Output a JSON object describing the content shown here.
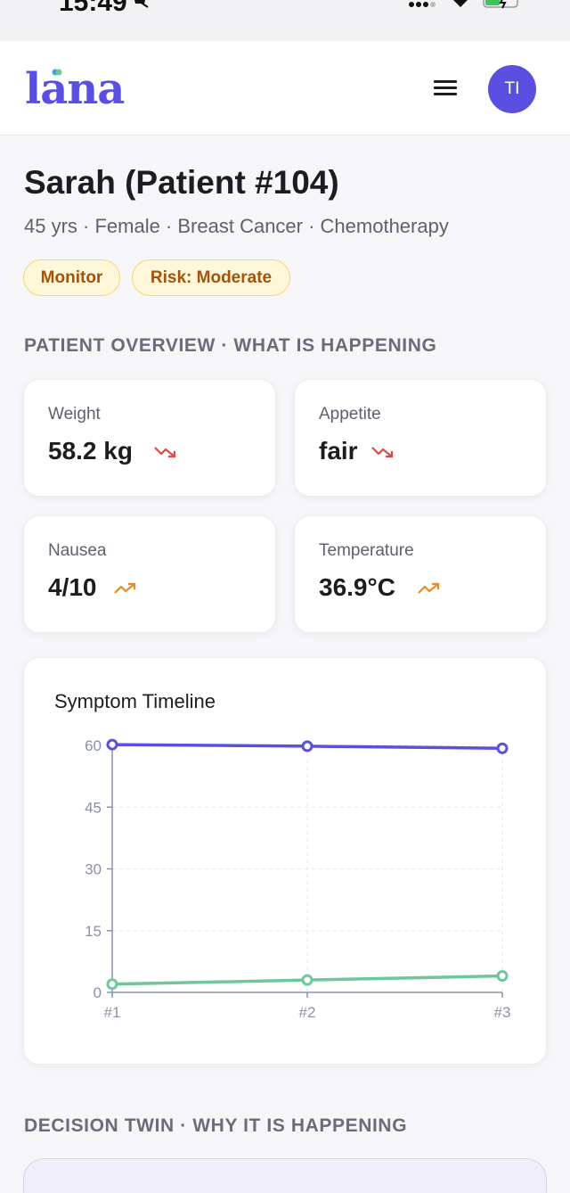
{
  "status_bar": {
    "time": "15:49",
    "icons": [
      "bell-muted-icon",
      "signal-icon",
      "wifi-icon",
      "battery-charging-icon"
    ]
  },
  "header": {
    "logo_text": "lana",
    "menu_icon": "hamburger-menu-icon",
    "avatar_initials": "TI",
    "accent_color": "#5a4fe0"
  },
  "patient": {
    "name": "Sarah (Patient #104)",
    "meta": "45 yrs · Female · Breast Cancer · Chemotherapy",
    "badges": [
      {
        "label": "Monitor",
        "color": "#a1540b"
      },
      {
        "label": "Risk: Moderate",
        "color": "#a1540b"
      }
    ]
  },
  "overview": {
    "section_title": "PATIENT OVERVIEW · WHAT IS HAPPENING",
    "stats": [
      {
        "label": "Weight",
        "value": "58.2 kg",
        "trend": "down",
        "trend_icon": "trend-down-icon",
        "trend_color": "#e04848"
      },
      {
        "label": "Appetite",
        "value": "fair",
        "trend": "down",
        "trend_icon": "trend-down-icon",
        "trend_color": "#e04848"
      },
      {
        "label": "Nausea",
        "value": "4/10",
        "trend": "up",
        "trend_icon": "trend-up-icon",
        "trend_color": "#ee8a1c"
      },
      {
        "label": "Temperature",
        "value": "36.9°C",
        "trend": "up",
        "trend_icon": "trend-up-icon",
        "trend_color": "#ee8a1c"
      }
    ]
  },
  "chart_data": {
    "type": "line",
    "title": "Symptom Timeline",
    "categories": [
      "#1",
      "#2",
      "#3"
    ],
    "y_ticks": [
      0,
      15,
      30,
      45,
      60
    ],
    "ylim": [
      0,
      60
    ],
    "grid": true,
    "series": [
      {
        "values": [
          60.2,
          59.8,
          59.3
        ],
        "color": "#5a4fe0"
      },
      {
        "values": [
          2,
          3,
          4
        ],
        "color": "#6cc79a"
      }
    ]
  },
  "decision": {
    "section_title": "DECISION TWIN · WHY IT IS HAPPENING"
  }
}
